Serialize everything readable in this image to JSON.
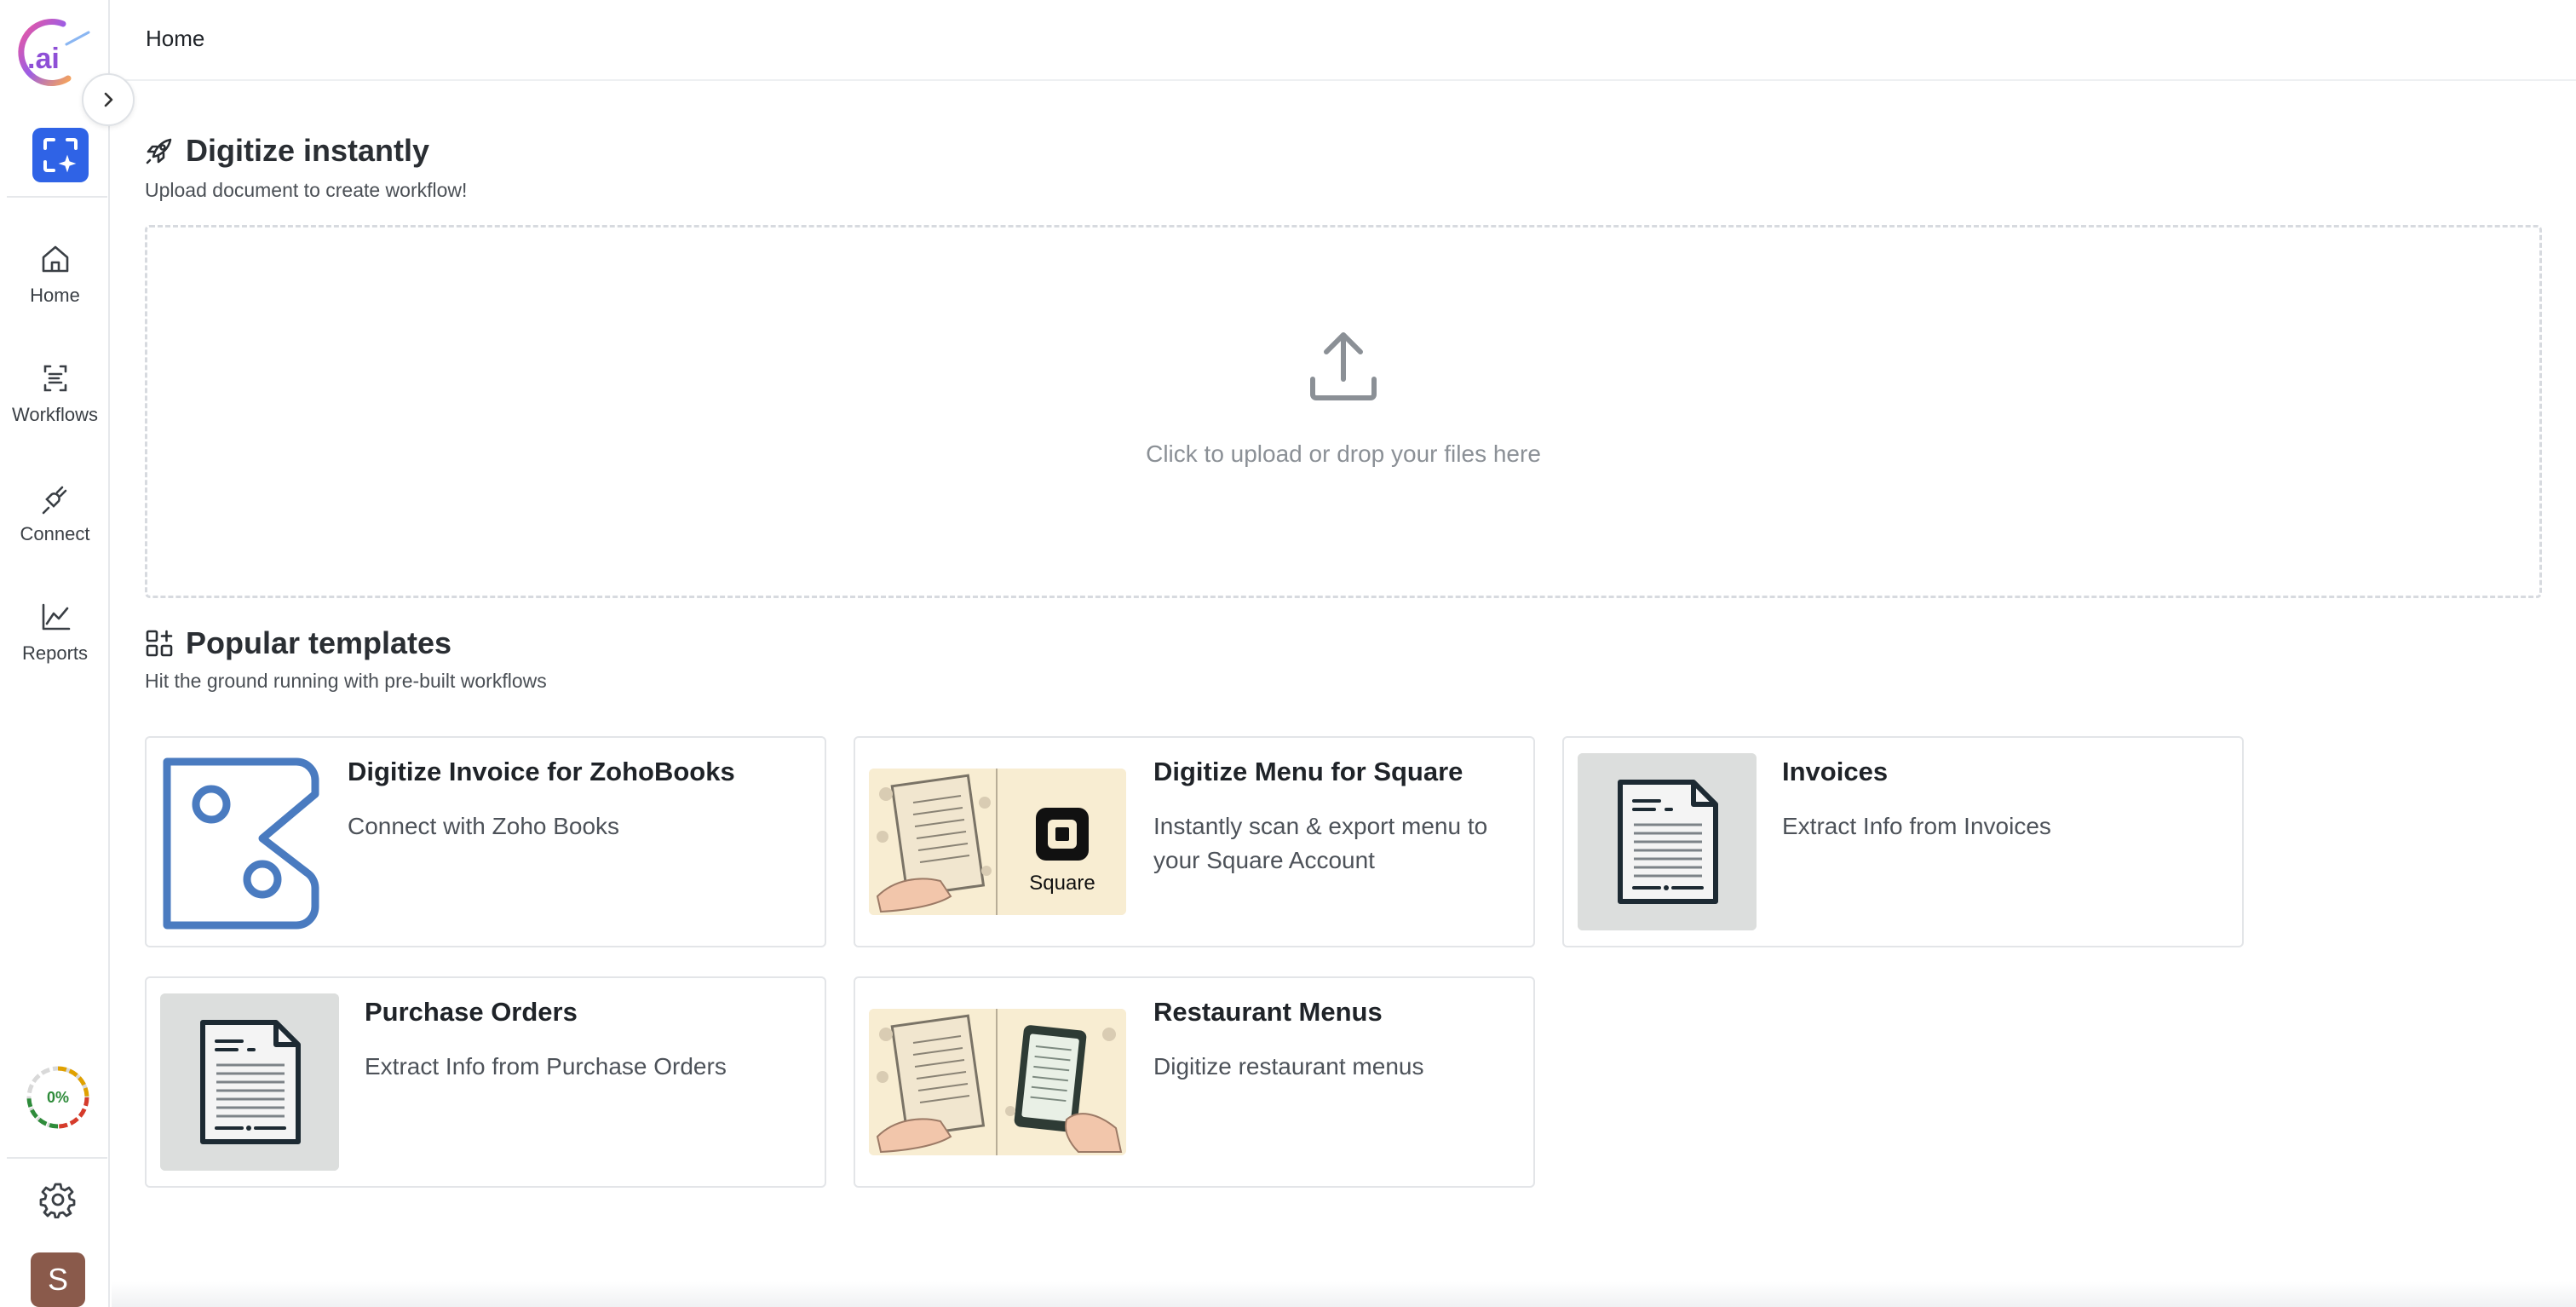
{
  "sidebar": {
    "logo_text": ".ai",
    "nav": [
      {
        "label": "Home",
        "icon": "home-icon"
      },
      {
        "label": "Workflows",
        "icon": "workflows-icon"
      },
      {
        "label": "Connect",
        "icon": "plug-icon"
      },
      {
        "label": "Reports",
        "icon": "reports-icon"
      }
    ],
    "usage_progress": "0%",
    "avatar_initial": "S",
    "colors": {
      "scan_button": "#2f63e6",
      "avatar": "#8a5a4b",
      "progress_text": "#2e8b3a"
    }
  },
  "header": {
    "breadcrumb": "Home"
  },
  "digitize": {
    "title": "Digitize instantly",
    "subtitle": "Upload document to create workflow!",
    "dropzone_text": "Click to upload or drop your files here"
  },
  "templates": {
    "title": "Popular templates",
    "subtitle": "Hit the ground running with pre-built workflows",
    "items": [
      {
        "title": "Digitize Invoice for ZohoBooks",
        "description": "Connect with Zoho Books",
        "thumb": "zoho-books-logo"
      },
      {
        "title": "Digitize Menu for Square",
        "description": "Instantly scan & export menu to your Square Account",
        "thumb": "menu-square-image",
        "thumb_label": "Square"
      },
      {
        "title": "Invoices",
        "description": "Extract Info from Invoices",
        "thumb": "document-icon"
      },
      {
        "title": "Purchase Orders",
        "description": "Extract Info from Purchase Orders",
        "thumb": "document-icon"
      },
      {
        "title": "Restaurant Menus",
        "description": "Digitize restaurant menus",
        "thumb": "menu-tablet-image"
      }
    ]
  }
}
